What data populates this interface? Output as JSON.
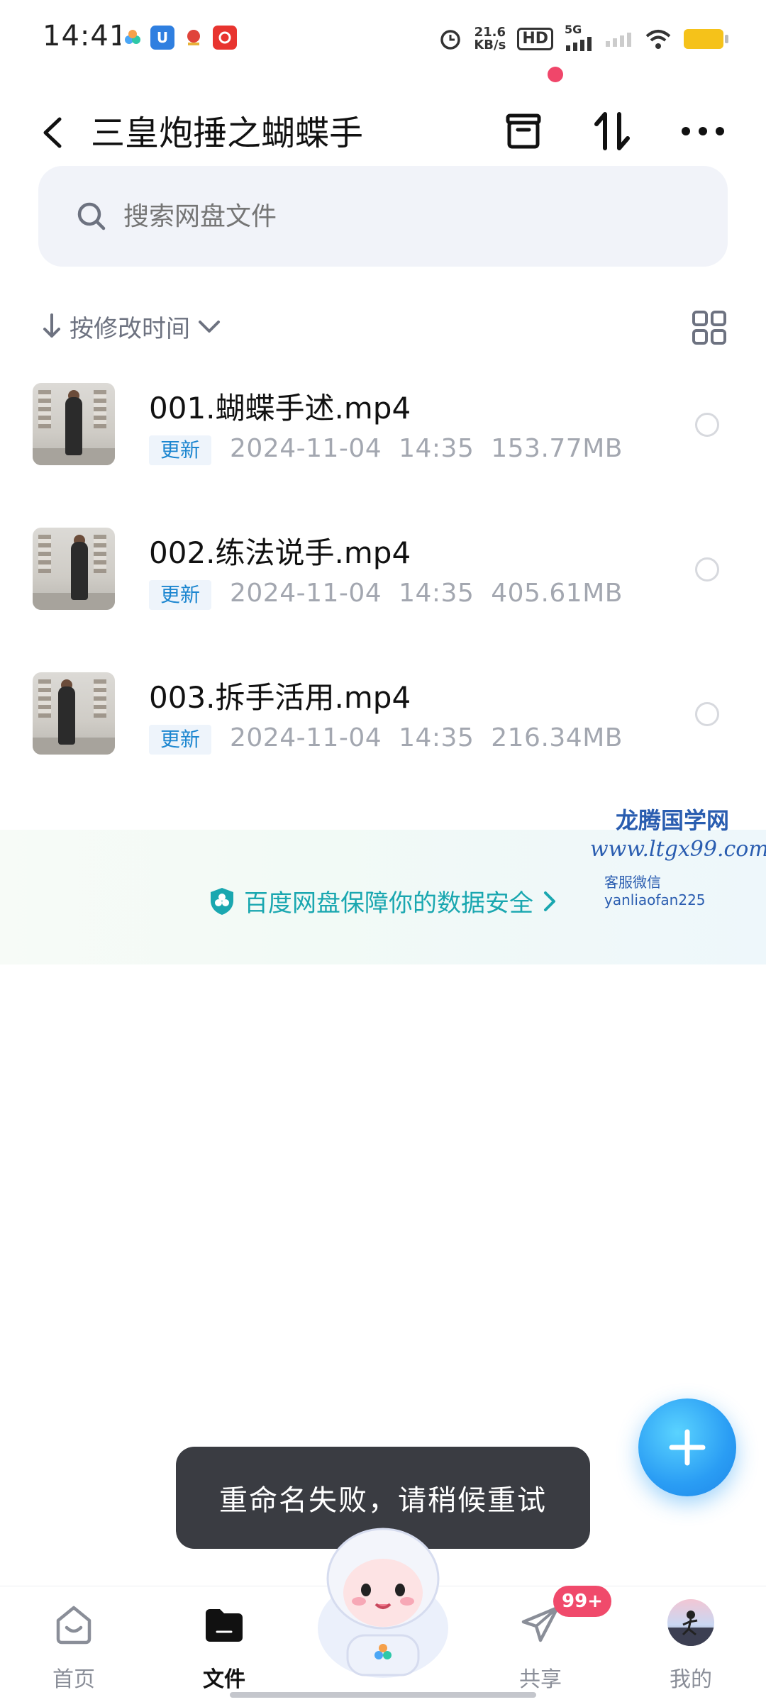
{
  "status_bar": {
    "time": "14:41",
    "net_speed_value": "21.6",
    "net_speed_unit": "KB/s",
    "hd_label": "HD",
    "signal_label": "5G",
    "battery_color": "#f5c21a"
  },
  "header": {
    "title": "三皇炮捶之蝴蝶手"
  },
  "search": {
    "placeholder": "搜索网盘文件"
  },
  "sort": {
    "label": "按修改时间"
  },
  "files": [
    {
      "name": "001.蝴蝶手述.mp4",
      "badge": "更新",
      "date": "2024-11-04",
      "time": "14:35",
      "size": "153.77MB"
    },
    {
      "name": "002.练法说手.mp4",
      "badge": "更新",
      "date": "2024-11-04",
      "time": "14:35",
      "size": "405.61MB"
    },
    {
      "name": "003.拆手活用.mp4",
      "badge": "更新",
      "date": "2024-11-04",
      "time": "14:35",
      "size": "216.34MB"
    }
  ],
  "watermark": {
    "line1": "龙腾国学网",
    "line2": "www.ltgx99.com",
    "line3": "客服微信 yanliaofan225"
  },
  "security_banner": {
    "text": "百度网盘保障你的数据安全"
  },
  "toast": {
    "message": "重命名失败，请稍候重试"
  },
  "bottom_nav": {
    "items": [
      {
        "label": "首页"
      },
      {
        "label": "文件"
      },
      {
        "label": "共享"
      },
      {
        "label": "我的"
      }
    ],
    "share_badge": "99+"
  },
  "colors": {
    "accent": "#2a9df4",
    "badge_red": "#f04a6b",
    "security_teal": "#1aa7b0",
    "update_blue": "#1c86d0"
  }
}
